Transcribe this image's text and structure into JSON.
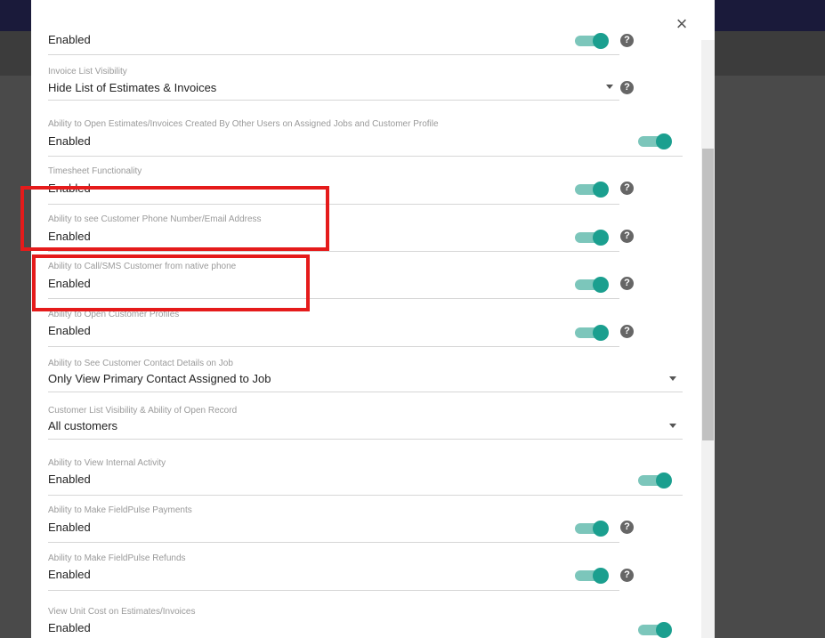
{
  "close_icon": "×",
  "help_glyph": "?",
  "rows": [
    {
      "label": "",
      "value": "Enabled"
    },
    {
      "label": "Invoice List Visibility",
      "value": "Hide List of Estimates & Invoices"
    },
    {
      "label": "Ability to Open Estimates/Invoices Created By Other Users on Assigned Jobs and Customer Profile",
      "value": "Enabled"
    },
    {
      "label": "Timesheet Functionality",
      "value": "Enabled"
    },
    {
      "label": "Ability to see Customer Phone Number/Email Address",
      "value": "Enabled"
    },
    {
      "label": "Ability to Call/SMS Customer from native phone",
      "value": "Enabled"
    },
    {
      "label": "Ability to Open Customer Profiles",
      "value": "Enabled"
    },
    {
      "label": "Ability to See Customer Contact Details on Job",
      "value": "Only View Primary Contact Assigned to Job"
    },
    {
      "label": "Customer List Visibility & Ability of Open Record",
      "value": "All customers"
    },
    {
      "label": "Ability to View Internal Activity",
      "value": "Enabled"
    },
    {
      "label": "Ability to Make FieldPulse Payments",
      "value": "Enabled"
    },
    {
      "label": "Ability to Make FieldPulse Refunds",
      "value": "Enabled"
    },
    {
      "label": "View Unit Cost on Estimates/Invoices",
      "value": "Enabled"
    }
  ],
  "colors": {
    "toggle_knob": "#1b9f8f",
    "toggle_track": "#7cc6bb",
    "highlight_border": "#e51b1b",
    "overlay": "#4a4a4a"
  }
}
